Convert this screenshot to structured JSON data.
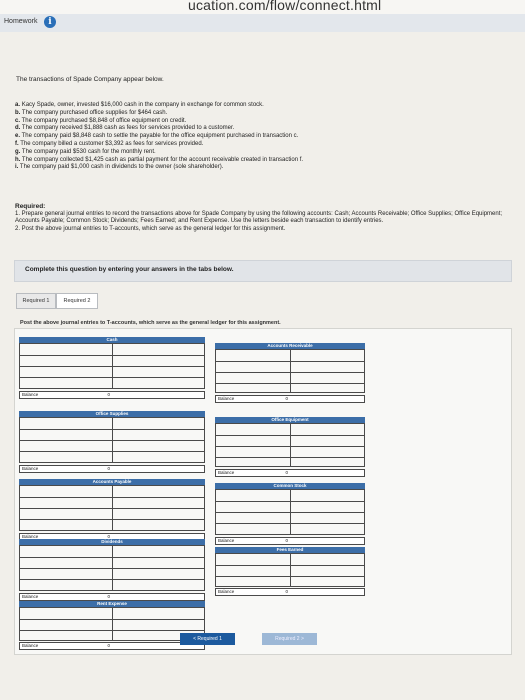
{
  "browser": {
    "url_fragment": "ucation.com/flow/connect.html"
  },
  "header": {
    "label": "Homework",
    "info_icon": "info-icon"
  },
  "problem": {
    "intro": "The transactions of Spade Company appear below.",
    "transactions": [
      {
        "letter": "a.",
        "text": "Kacy Spade, owner, invested $16,000 cash in the company in exchange for common stock."
      },
      {
        "letter": "b.",
        "text": "The company purchased office supplies for $464 cash."
      },
      {
        "letter": "c.",
        "text": "The company purchased $8,848 of office equipment on credit."
      },
      {
        "letter": "d.",
        "text": "The company received $1,888 cash as fees for services provided to a customer."
      },
      {
        "letter": "e.",
        "text": "The company paid $8,848 cash to settle the payable for the office equipment purchased in transaction c."
      },
      {
        "letter": "f.",
        "text": "The company billed a customer $3,392 as fees for services provided."
      },
      {
        "letter": "g.",
        "text": "The company paid $530 cash for the monthly rent."
      },
      {
        "letter": "h.",
        "text": "The company collected $1,425 cash as partial payment for the account receivable created in transaction f."
      },
      {
        "letter": "i.",
        "text": "The company paid $1,000 cash in dividends to the owner (sole shareholder)."
      }
    ],
    "required_title": "Required:",
    "required_1": "1. Prepare general journal entries to record the transactions above for Spade Company by using the following accounts: Cash; Accounts Receivable; Office Supplies; Office Equipment; Accounts Payable; Common Stock; Dividends; Fees Earned; and Rent Expense. Use the letters beside each transaction to identify entries.",
    "required_2": "2. Post the above journal entries to T-accounts, which serve as the general ledger for this assignment."
  },
  "instruction_band": "Complete this question by entering your answers in the tabs below.",
  "tabs": [
    {
      "label": "Required 1"
    },
    {
      "label": "Required 2"
    }
  ],
  "post_instruction": "Post the above journal entries to T-accounts, which serve as the general ledger for this assignment.",
  "t_accounts": [
    {
      "title": "Cash",
      "balance_label": "Balance",
      "balance_value": "0"
    },
    {
      "title": "Accounts Receivable",
      "balance_label": "Balance",
      "balance_value": "0"
    },
    {
      "title": "Office Supplies",
      "balance_label": "Balance",
      "balance_value": "0"
    },
    {
      "title": "Office Equipment",
      "balance_label": "Balance",
      "balance_value": "0"
    },
    {
      "title": "Accounts Payable",
      "balance_label": "Balance",
      "balance_value": "0"
    },
    {
      "title": "Common Stock",
      "balance_label": "Balance",
      "balance_value": "0"
    },
    {
      "title": "Dividends",
      "balance_label": "Balance",
      "balance_value": "0"
    },
    {
      "title": "Fees Earned",
      "balance_label": "Balance",
      "balance_value": "0"
    },
    {
      "title": "Rent Expense",
      "balance_label": "Balance",
      "balance_value": "0"
    }
  ],
  "navigation": {
    "prev_label": "< Required 1",
    "next_label": "Required 2 >"
  },
  "colors": {
    "accent": "#3c6ea8",
    "nav_active": "#1c5a9e",
    "nav_disabled": "#9db8d6"
  }
}
